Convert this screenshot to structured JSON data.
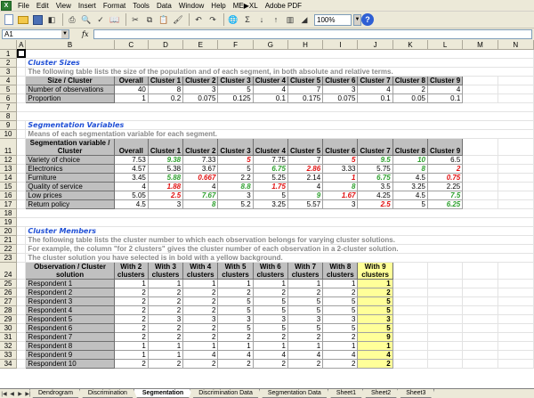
{
  "menubar": {
    "items": [
      "File",
      "Edit",
      "View",
      "Insert",
      "Format",
      "Tools",
      "Data",
      "Window",
      "Help",
      "ME▶XL",
      "Adobe PDF"
    ]
  },
  "toolbar": {
    "zoom": "100%",
    "sum_icon": "Σ"
  },
  "formulabar": {
    "name_box": "A1",
    "fx_label": "fx",
    "content": ""
  },
  "columns": [
    "A",
    "B",
    "C",
    "D",
    "E",
    "F",
    "G",
    "H",
    "I",
    "J",
    "K",
    "L",
    "M",
    "N"
  ],
  "rows": [
    "1",
    "2",
    "3",
    "4",
    "5",
    "6",
    "7",
    "8",
    "9",
    "10",
    "11",
    "12",
    "13",
    "14",
    "15",
    "16",
    "17",
    "18",
    "19",
    "20",
    "21",
    "22",
    "23",
    "24",
    "25",
    "26",
    "27",
    "28",
    "29",
    "30",
    "31",
    "32",
    "33"
  ],
  "cluster_sizes": {
    "title": "Cluster Sizes",
    "desc": "The following table lists the size of the population and of each segment, in both absolute and relative terms.",
    "header": [
      "Size / Cluster",
      "Overall",
      "Cluster 1",
      "Cluster 2",
      "Cluster 3",
      "Cluster 4",
      "Cluster 5",
      "Cluster 6",
      "Cluster 7",
      "Cluster 8",
      "Cluster 9"
    ],
    "rows": [
      [
        "Number of observations",
        "40",
        "8",
        "3",
        "5",
        "4",
        "7",
        "3",
        "4",
        "2",
        "4"
      ],
      [
        "Proportion",
        "1",
        "0.2",
        "0.075",
        "0.125",
        "0.1",
        "0.175",
        "0.075",
        "0.1",
        "0.05",
        "0.1"
      ]
    ]
  },
  "segmentation": {
    "title": "Segmentation Variables",
    "desc": "Means of each segmentation variable for each segment.",
    "header": [
      "Segmentation variable / Cluster",
      "Overall",
      "Cluster 1",
      "Cluster 2",
      "Cluster 3",
      "Cluster 4",
      "Cluster 5",
      "Cluster 6",
      "Cluster 7",
      "Cluster 8",
      "Cluster 9"
    ],
    "rows": [
      {
        "cells": [
          "Variety of choice",
          "7.53",
          "9.38",
          "7.33",
          "5",
          "7.75",
          "7",
          "5",
          "9.5",
          "10",
          "6.5"
        ],
        "styles": [
          "",
          "",
          "g",
          "",
          "r",
          "",
          "",
          "r",
          "g",
          "g",
          ""
        ]
      },
      {
        "cells": [
          "Electronics",
          "4.57",
          "5.38",
          "3.67",
          "5",
          "6.75",
          "2.86",
          "3.33",
          "5.75",
          "8",
          "2"
        ],
        "styles": [
          "",
          "",
          "",
          "",
          "",
          "g",
          "r",
          "",
          "",
          "g",
          "r"
        ]
      },
      {
        "cells": [
          "Furniture",
          "3.45",
          "5.88",
          "0.667",
          "2.2",
          "5.25",
          "2.14",
          "1",
          "6.75",
          "4.5",
          "0.75"
        ],
        "styles": [
          "",
          "",
          "g",
          "r",
          "",
          "",
          "",
          "r",
          "g",
          "",
          "r"
        ]
      },
      {
        "cells": [
          "Quality of service",
          "4",
          "1.88",
          "4",
          "8.8",
          "1.75",
          "4",
          "8",
          "3.5",
          "3.25",
          "2.25"
        ],
        "styles": [
          "",
          "",
          "r",
          "",
          "g",
          "r",
          "",
          "g",
          "",
          "",
          ""
        ]
      },
      {
        "cells": [
          "Low prices",
          "5.05",
          "2.5",
          "7.67",
          "3",
          "5",
          "9",
          "1.67",
          "4.25",
          "4.5",
          "7.5"
        ],
        "styles": [
          "",
          "",
          "r",
          "g",
          "",
          "",
          "g",
          "r",
          "",
          "",
          "g"
        ]
      },
      {
        "cells": [
          "Return policy",
          "4.5",
          "3",
          "8",
          "5.2",
          "3.25",
          "5.57",
          "3",
          "2.5",
          "5",
          "6.25"
        ],
        "styles": [
          "",
          "",
          "",
          "g",
          "",
          "",
          "",
          "",
          "r",
          "",
          "g"
        ]
      }
    ]
  },
  "cluster_members": {
    "title": "Cluster Members",
    "desc": [
      "The following table lists the cluster number to which each observation belongs for varying cluster solutions.",
      "For example, the column \"for 2 clusters\" gives the cluster number of each observation in a 2-cluster solution.",
      "The cluster solution you have selected is in bold with a yellow background."
    ],
    "header": [
      "Observation / Cluster solution",
      "With 2 clusters",
      "With 3 clusters",
      "With 4 clusters",
      "With 5 clusters",
      "With 6 clusters",
      "With 7 clusters",
      "With 8 clusters",
      "With 9 clusters"
    ],
    "rows": [
      [
        "Respondent 1",
        "1",
        "1",
        "1",
        "1",
        "1",
        "1",
        "1",
        "1"
      ],
      [
        "Respondent 2",
        "2",
        "2",
        "2",
        "2",
        "2",
        "2",
        "2",
        "2"
      ],
      [
        "Respondent 3",
        "2",
        "2",
        "2",
        "5",
        "5",
        "5",
        "5",
        "5"
      ],
      [
        "Respondent 4",
        "2",
        "2",
        "2",
        "5",
        "5",
        "5",
        "5",
        "5"
      ],
      [
        "Respondent 5",
        "2",
        "3",
        "3",
        "3",
        "3",
        "3",
        "3",
        "3"
      ],
      [
        "Respondent 6",
        "2",
        "2",
        "2",
        "5",
        "5",
        "5",
        "5",
        "5"
      ],
      [
        "Respondent 7",
        "2",
        "2",
        "2",
        "2",
        "2",
        "2",
        "2",
        "9"
      ],
      [
        "Respondent 8",
        "1",
        "1",
        "1",
        "1",
        "1",
        "1",
        "1",
        "1"
      ],
      [
        "Respondent 9",
        "1",
        "1",
        "4",
        "4",
        "4",
        "4",
        "4",
        "4"
      ],
      [
        "Respondent 10",
        "2",
        "2",
        "2",
        "2",
        "2",
        "2",
        "2",
        "2"
      ]
    ]
  },
  "sheet_tabs": [
    "Dendrogram",
    "Discrimination",
    "Segmentation",
    "Discrimination Data",
    "Segmentation Data",
    "Sheet1",
    "Sheet2",
    "Sheet3"
  ],
  "active_tab": "Segmentation",
  "colors": {
    "title_blue": "#1f4fd6",
    "highlight_yellow": "#ffff99",
    "green": "#2ea02e",
    "red": "#e01010",
    "header_gray": "#c0c0c0"
  }
}
